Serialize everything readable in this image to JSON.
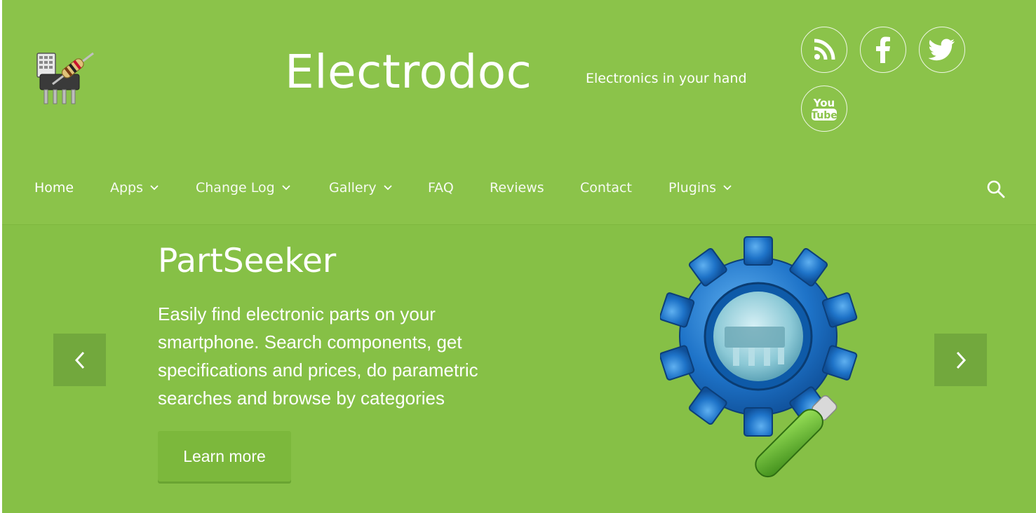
{
  "header": {
    "site_title": "Electrodoc",
    "tagline": "Electronics in your hand",
    "social": [
      {
        "icon": "rss-icon",
        "label": "RSS"
      },
      {
        "icon": "facebook-icon",
        "label": "Facebook"
      },
      {
        "icon": "twitter-icon",
        "label": "Twitter"
      },
      {
        "icon": "youtube-icon",
        "label": "YouTube",
        "text_top": "You",
        "text_bottom": "Tube"
      }
    ]
  },
  "nav": {
    "items": [
      {
        "label": "Home",
        "has_dropdown": false
      },
      {
        "label": "Apps",
        "has_dropdown": true
      },
      {
        "label": "Change Log",
        "has_dropdown": true
      },
      {
        "label": "Gallery",
        "has_dropdown": true
      },
      {
        "label": "FAQ",
        "has_dropdown": false
      },
      {
        "label": "Reviews",
        "has_dropdown": false
      },
      {
        "label": "Contact",
        "has_dropdown": false
      },
      {
        "label": "Plugins",
        "has_dropdown": true
      }
    ],
    "search_icon": "search-icon"
  },
  "slide": {
    "title": "PartSeeker",
    "description": "Easily find electronic parts on your smartphone. Search components, get specifications and prices, do parametric searches and browse by categories",
    "button_label": "Learn more"
  },
  "colors": {
    "background": "#8bc34a",
    "accent_dark": "#72a83d",
    "text": "#ffffff"
  }
}
